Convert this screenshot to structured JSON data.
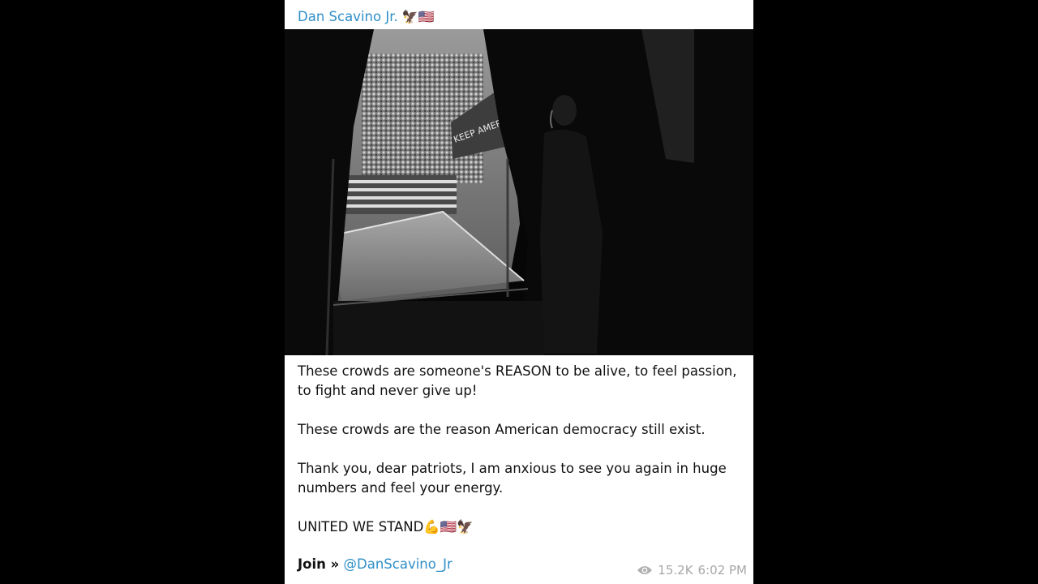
{
  "post": {
    "channel_name": "Dan Scavino Jr.",
    "header_emoji": "🦅🇺🇸",
    "caption": {
      "p1": "These crowds are  someone's REASON to be alive, to feel passion, to fight and never give up!",
      "p2": "These crowds are the reason American democracy still exist.",
      "p3": "Thank you, dear patriots, I am anxious to see you again in huge numbers and feel your energy.",
      "p4": "UNITED WE STAND💪🇺🇸🦅"
    },
    "join_label": "Join »",
    "join_handle": "@DanScavino_Jr",
    "views": "15.2K",
    "time": "6:02 PM"
  },
  "photo": {
    "banner_text": "KEEP AMERICA GREAT"
  },
  "colors": {
    "link": "#2f8fc8",
    "meta": "#a7a7a7",
    "background": "#000000",
    "card": "#ffffff"
  },
  "icons": {
    "views": "eye-icon"
  }
}
